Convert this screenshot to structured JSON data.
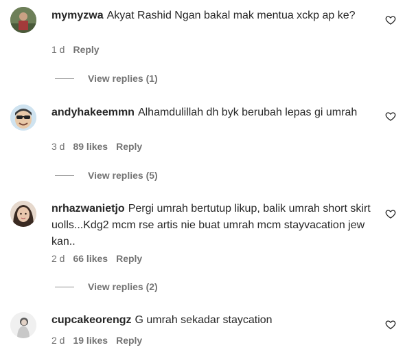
{
  "comments": [
    {
      "username": "mymyzwa",
      "text": "Akyat Rashid Ngan bakal mak mentua xckp ap ke?",
      "time": "1 d",
      "likes": "",
      "reply_label": "Reply",
      "view_replies": "View replies (1)",
      "avatar_icon": "avatar-photo"
    },
    {
      "username": "andyhakeemmn",
      "text": "Alhamdulillah dh byk berubah lepas gi umrah",
      "time": "3 d",
      "likes": "89 likes",
      "reply_label": "Reply",
      "view_replies": "View replies (5)",
      "avatar_icon": "cartoon-avatar"
    },
    {
      "username": "nrhazwanietjo",
      "text": "Pergi umrah bertutup likup, balik umrah short skirt uolls...Kdg2 mcm rse artis nie buat umrah mcm stayvacation jew kan..",
      "time": "2 d",
      "likes": "66 likes",
      "reply_label": "Reply",
      "view_replies": "View replies (2)",
      "avatar_icon": "avatar-photo"
    },
    {
      "username": "cupcakeorengz",
      "text": "G umrah sekadar staycation",
      "time": "2 d",
      "likes": "19 likes",
      "reply_label": "Reply",
      "view_replies": "",
      "avatar_icon": "avatar-photo"
    }
  ],
  "colors": {
    "text": "#262626",
    "secondary": "#737373",
    "divider": "#8e8e8e"
  }
}
